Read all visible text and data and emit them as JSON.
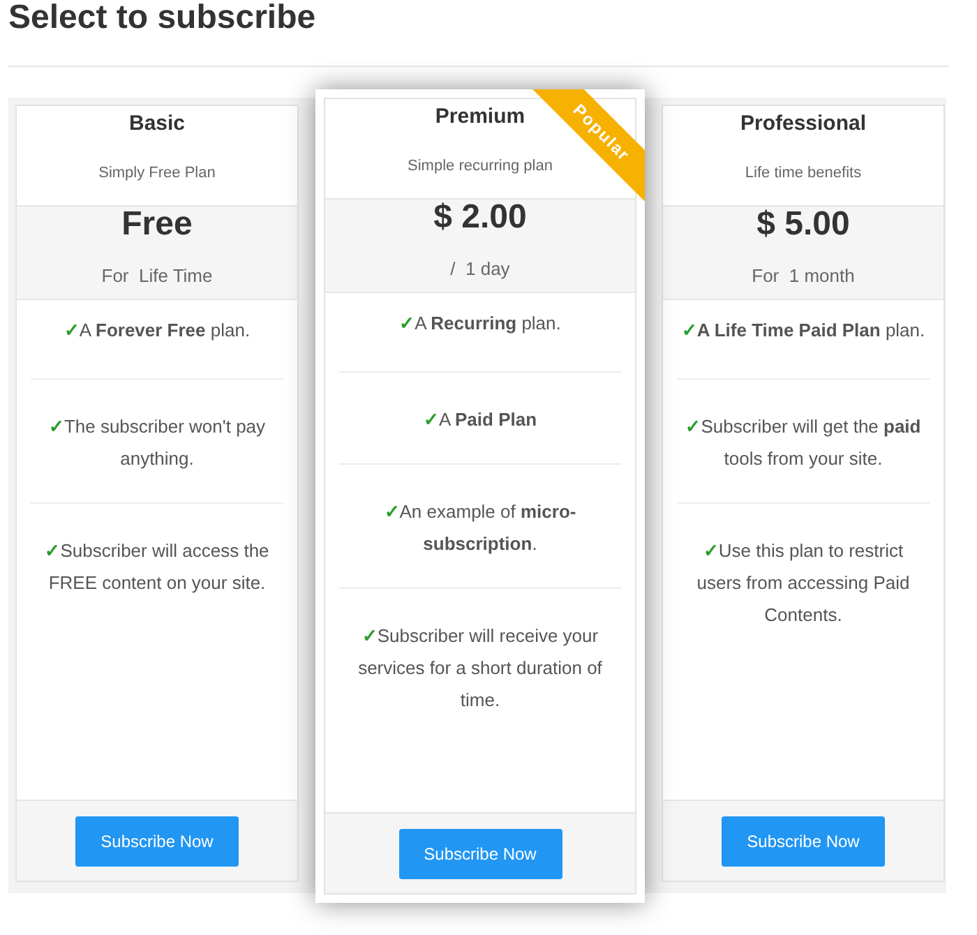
{
  "heading": "Select to subscribe",
  "plans": [
    {
      "title": "Basic",
      "subtitle": "Simply Free Plan",
      "price": "Free",
      "period": "For  Life Time",
      "featured": false,
      "features": [
        {
          "check": "✓",
          "text": "A **Forever Free** plan."
        },
        {
          "check": "✓",
          "text": "The subscriber won't pay anything."
        },
        {
          "check": "✓",
          "text": "Subscriber will access the FREE content on your site."
        }
      ],
      "button": "Subscribe Now"
    },
    {
      "title": "Premium",
      "subtitle": "Simple recurring plan",
      "price": "$ 2.00",
      "period": "/  1 day",
      "featured": true,
      "ribbon": "Popular",
      "features": [
        {
          "check": "✓",
          "text": "A **Recurring** plan."
        },
        {
          "check": "✓",
          "text": "A **Paid Plan**"
        },
        {
          "check": "✓",
          "text": "An example of **micro-subscription**."
        },
        {
          "check": "✓",
          "text": "Subscriber will receive your services for a short duration of time."
        }
      ],
      "button": "Subscribe Now"
    },
    {
      "title": "Professional",
      "subtitle": "Life time benefits",
      "price": "$ 5.00",
      "period": "For  1 month",
      "featured": false,
      "features": [
        {
          "check": "✓",
          "text": "**A Life Time Paid Plan** plan."
        },
        {
          "check": "✓",
          "text": "Subscriber will get the **paid** tools from your site."
        },
        {
          "check": "✓",
          "text": "Use this plan to restrict users from accessing Paid Contents."
        }
      ],
      "button": "Subscribe Now"
    }
  ]
}
